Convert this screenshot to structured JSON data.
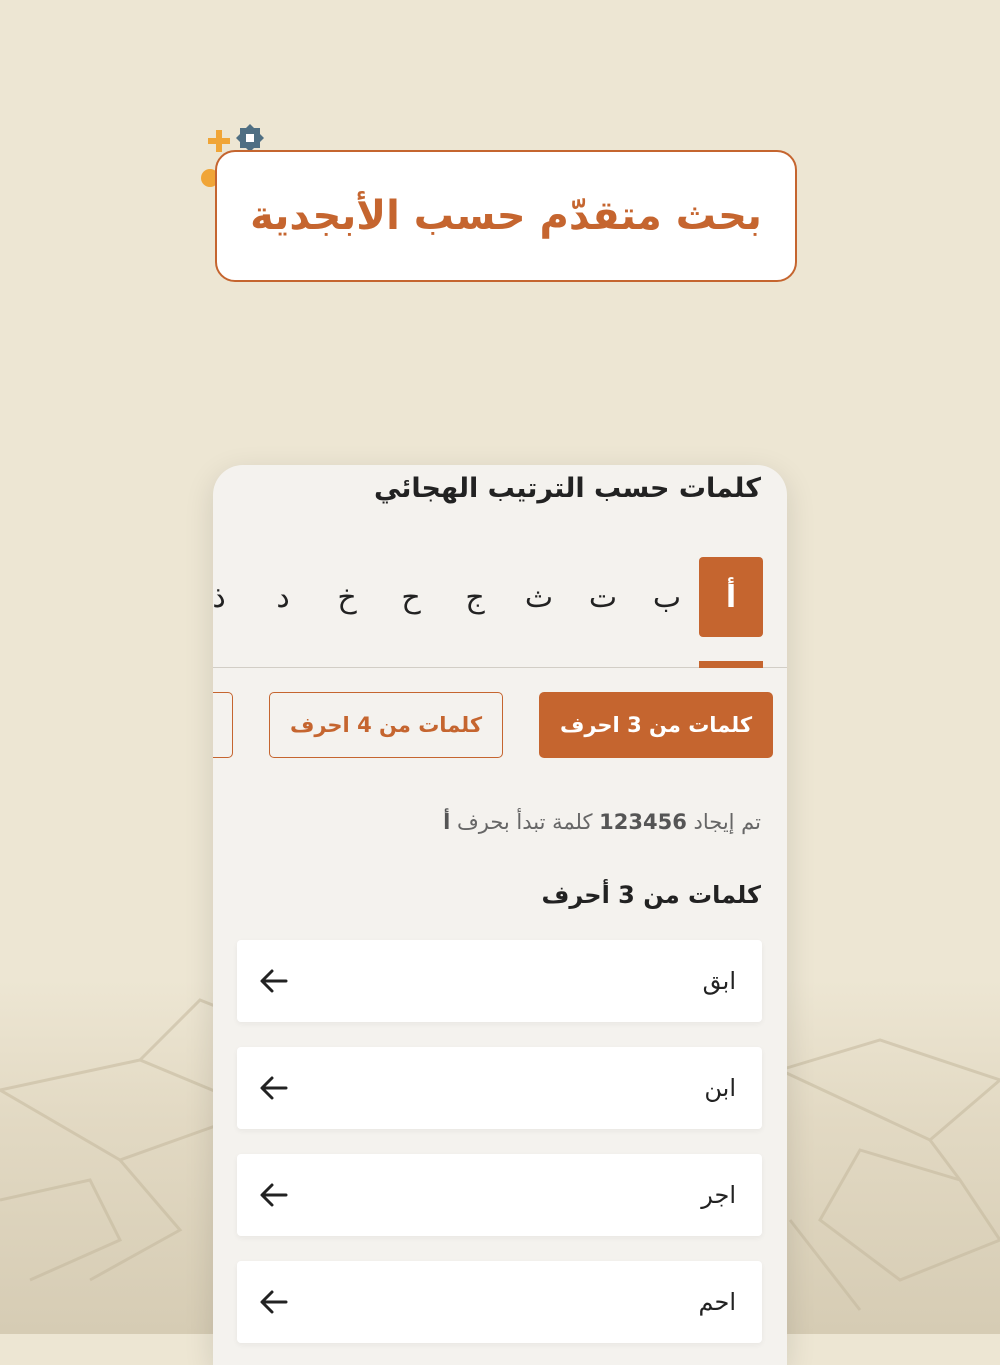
{
  "banner": {
    "title": "بحث متقدّم حسب الأبجدية"
  },
  "screen": {
    "title": "كلمات حسب الترتيب الهجائي",
    "letters": [
      "أ",
      "ب",
      "ت",
      "ث",
      "ج",
      "ح",
      "خ",
      "د",
      "ذ"
    ],
    "active_letter": "أ",
    "chips": [
      {
        "label": "كلمات من 3 احرف",
        "active": true
      },
      {
        "label": "كلمات من 4 احرف",
        "active": false
      },
      {
        "label": "",
        "active": false
      }
    ],
    "result": {
      "prefix": "تم إيجاد",
      "count": "123456",
      "middle": "كلمة تبدأ بحرف",
      "letter": "أ"
    },
    "section_title": "كلمات من 3 أحرف",
    "words": [
      "ابق",
      "ابن",
      "اجر",
      "احم"
    ]
  },
  "colors": {
    "accent": "#c5652f",
    "background": "#ede6d3",
    "card": "#f4f2ee"
  },
  "icons": {
    "row_arrow": "arrow-left-icon",
    "decoration": "stars-icon"
  }
}
